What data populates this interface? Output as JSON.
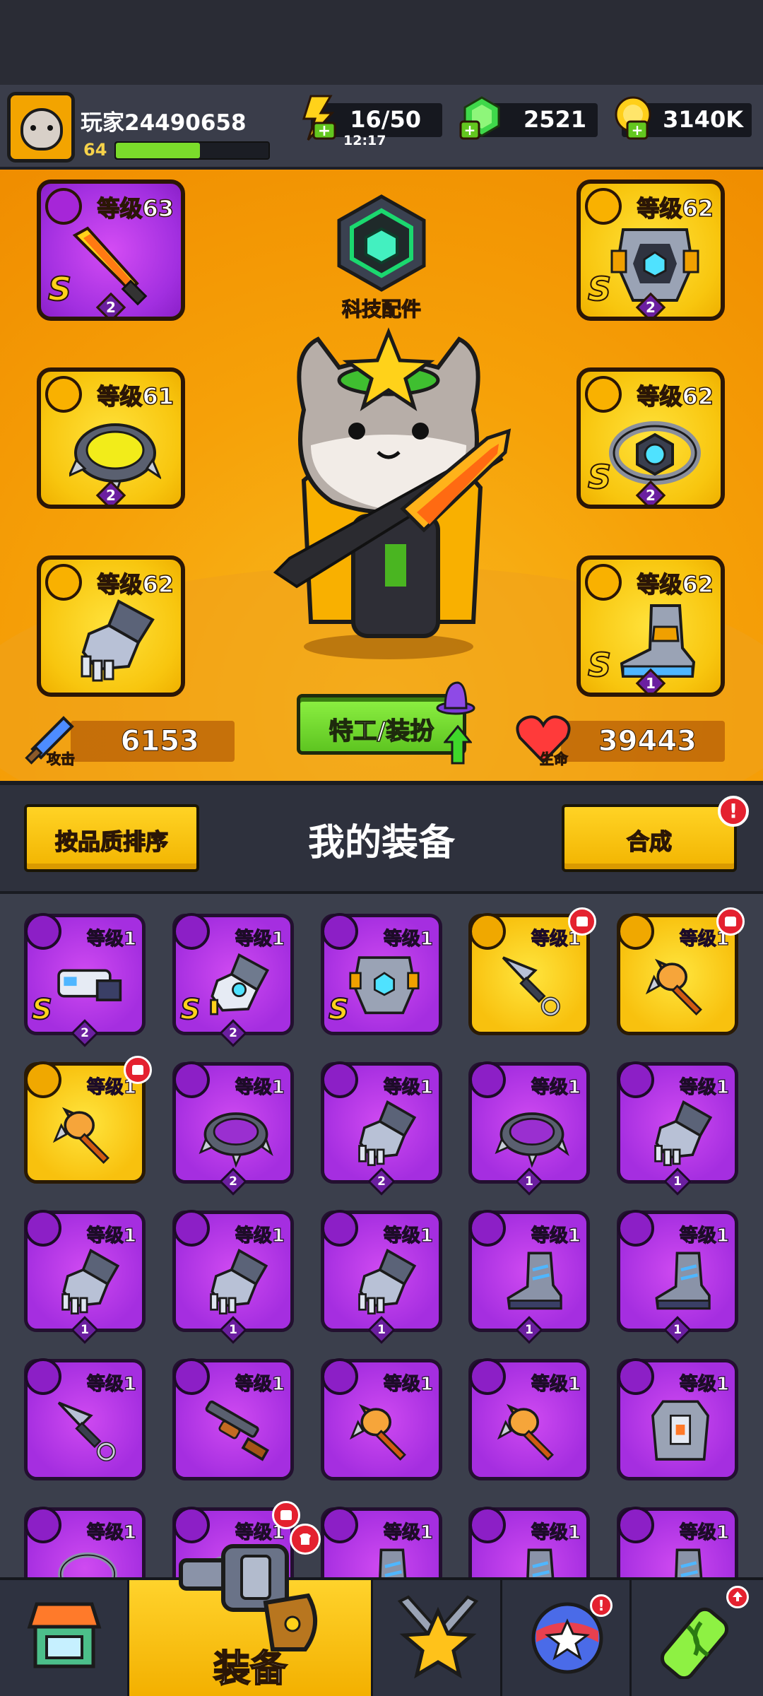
{
  "player": {
    "name": "玩家24490658",
    "level": "64",
    "xp_fraction": 0.55
  },
  "resources": {
    "energy": "16/50",
    "energy_timer": "12:17",
    "gems": "2521",
    "gold": "3140K"
  },
  "hero": {
    "tech_label": "科技配件",
    "costume_button": "特工/装扮",
    "attack_label": "攻击",
    "attack_value": "6153",
    "hp_label": "生命",
    "hp_value": "39443"
  },
  "equipped_slots": [
    {
      "slot": "weapon",
      "level": "等级63",
      "rank": "S",
      "stars": "2",
      "color": "purple",
      "icon": "sword-icon"
    },
    {
      "slot": "armor",
      "level": "等级62",
      "rank": "S",
      "stars": "2",
      "color": "yellow",
      "icon": "armor-icon"
    },
    {
      "slot": "necklace",
      "level": "等级61",
      "rank": "",
      "stars": "2",
      "color": "yellow",
      "icon": "spiked-collar-icon"
    },
    {
      "slot": "belt",
      "level": "等级62",
      "rank": "S",
      "stars": "2",
      "color": "yellow",
      "icon": "belt-icon"
    },
    {
      "slot": "gloves",
      "level": "等级62",
      "rank": "",
      "stars": "",
      "color": "yellow",
      "icon": "gauntlet-icon"
    },
    {
      "slot": "boots",
      "level": "等级62",
      "rank": "S",
      "stars": "1",
      "color": "yellow",
      "icon": "boot-icon"
    }
  ],
  "equipment_section": {
    "title": "我的装备",
    "sort_label": "按品质排序",
    "merge_label": "合成",
    "merge_alert": "!"
  },
  "inventory": [
    {
      "level": "等级1",
      "color": "purple",
      "rank": "S",
      "stars": "2",
      "icon": "blaster-icon",
      "new": false
    },
    {
      "level": "等级1",
      "color": "purple",
      "rank": "S",
      "stars": "2",
      "icon": "tech-gauntlet-icon",
      "new": false
    },
    {
      "level": "等级1",
      "color": "purple",
      "rank": "S",
      "stars": "",
      "icon": "armor-icon",
      "new": false
    },
    {
      "level": "等级1",
      "color": "yellow",
      "rank": "",
      "stars": "",
      "icon": "kunai-icon",
      "new": true
    },
    {
      "level": "等级1",
      "color": "yellow",
      "rank": "",
      "stars": "",
      "icon": "spear-icon",
      "new": true
    },
    {
      "level": "等级1",
      "color": "yellow",
      "rank": "",
      "stars": "",
      "icon": "spear-icon",
      "new": true
    },
    {
      "level": "等级1",
      "color": "purple",
      "rank": "",
      "stars": "2",
      "icon": "spiked-collar-icon",
      "new": false
    },
    {
      "level": "等级1",
      "color": "purple",
      "rank": "",
      "stars": "2",
      "icon": "gauntlet-icon",
      "new": false
    },
    {
      "level": "等级1",
      "color": "purple",
      "rank": "",
      "stars": "1",
      "icon": "spiked-collar-icon",
      "new": false
    },
    {
      "level": "等级1",
      "color": "purple",
      "rank": "",
      "stars": "1",
      "icon": "gauntlet-icon",
      "new": false
    },
    {
      "level": "等级1",
      "color": "purple",
      "rank": "",
      "stars": "1",
      "icon": "gauntlet-icon",
      "new": false
    },
    {
      "level": "等级1",
      "color": "purple",
      "rank": "",
      "stars": "1",
      "icon": "gauntlet-icon",
      "new": false
    },
    {
      "level": "等级1",
      "color": "purple",
      "rank": "",
      "stars": "1",
      "icon": "gauntlet-icon",
      "new": false
    },
    {
      "level": "等级1",
      "color": "purple",
      "rank": "",
      "stars": "1",
      "icon": "boot-icon",
      "new": false
    },
    {
      "level": "等级1",
      "color": "purple",
      "rank": "",
      "stars": "1",
      "icon": "boot-icon",
      "new": false
    },
    {
      "level": "等级1",
      "color": "purple",
      "rank": "",
      "stars": "",
      "icon": "kunai-icon",
      "new": false
    },
    {
      "level": "等级1",
      "color": "purple",
      "rank": "",
      "stars": "",
      "icon": "shotgun-icon",
      "new": false
    },
    {
      "level": "等级1",
      "color": "purple",
      "rank": "",
      "stars": "",
      "icon": "spear-icon",
      "new": false
    },
    {
      "level": "等级1",
      "color": "purple",
      "rank": "",
      "stars": "",
      "icon": "spear-icon",
      "new": false
    },
    {
      "level": "等级1",
      "color": "purple",
      "rank": "",
      "stars": "",
      "icon": "vest-icon",
      "new": false
    },
    {
      "level": "等级1",
      "color": "purple",
      "rank": "",
      "stars": "",
      "icon": "chain-necklace-icon",
      "new": false
    },
    {
      "level": "等级1",
      "color": "purple",
      "rank": "",
      "stars": "",
      "icon": "belt-icon",
      "new": true
    },
    {
      "level": "等级1",
      "color": "purple",
      "rank": "",
      "stars": "",
      "icon": "boot-icon",
      "new": false
    },
    {
      "level": "等级1",
      "color": "purple",
      "rank": "",
      "stars": "",
      "icon": "boot-icon",
      "new": false
    },
    {
      "level": "等级1",
      "color": "purple",
      "rank": "",
      "stars": "",
      "icon": "boot-icon",
      "new": false
    }
  ],
  "nav": {
    "tabs": [
      {
        "name": "shop",
        "icon": "shop-icon",
        "label": "",
        "active": false
      },
      {
        "name": "equipment",
        "icon": "revolver-icon",
        "label": "装备",
        "active": true
      },
      {
        "name": "battle",
        "icon": "star-swords-icon",
        "label": "",
        "active": false
      },
      {
        "name": "gacha",
        "icon": "star-orb-icon",
        "label": "",
        "active": false,
        "alert": "!"
      },
      {
        "name": "evolve",
        "icon": "dna-capsule-icon",
        "label": "",
        "active": false
      }
    ]
  }
}
